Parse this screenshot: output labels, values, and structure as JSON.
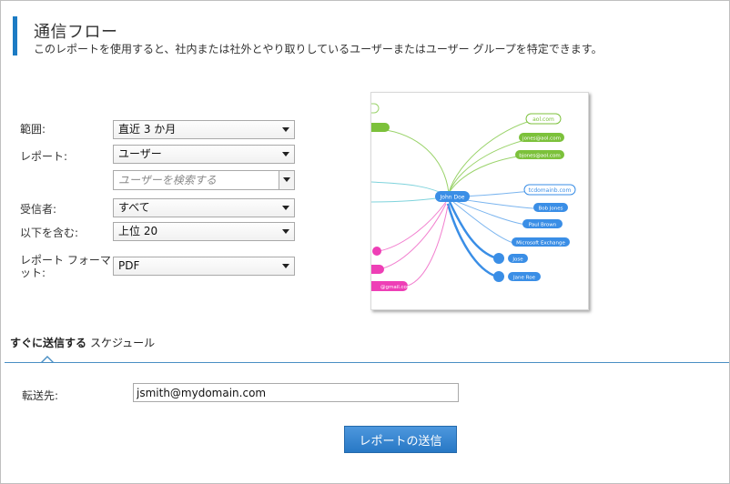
{
  "header": {
    "title": "通信フロー",
    "description": "このレポートを使用すると、社内または社外とやり取りしているユーザーまたはユーザー グループを特定できます。"
  },
  "form": {
    "range": {
      "label": "範囲:",
      "value": "直近 3 か月"
    },
    "report": {
      "label": "レポート:",
      "value": "ユーザー"
    },
    "user_search": {
      "placeholder": "ユーザーを検索する"
    },
    "recipients": {
      "label": "受信者:",
      "value": "すべて"
    },
    "include": {
      "label": "以下を含む:",
      "value": "上位 20"
    },
    "format": {
      "label": "レポート フォーマット:",
      "value": "PDF"
    }
  },
  "preview": {
    "center": "John Doe",
    "top_group": "aol.com",
    "top_nodes": [
      "jones@aol.com",
      "bjones@aol.com"
    ],
    "right_group": "tcdomainb.com",
    "right_nodes": [
      "Bob Jones",
      "Paul Brown",
      "Microsoft Exchange",
      "Jose",
      "Jane Roe"
    ],
    "left_node": "@gmail.com",
    "colors": {
      "green": "#7cc13b",
      "blue": "#3a8ee6",
      "pink": "#ee3fb6",
      "teal": "#5bc7d2"
    }
  },
  "tabs": {
    "send_now": "すぐに送信する",
    "schedule": "スケジュール"
  },
  "send": {
    "forward_label": "転送先:",
    "forward_value": "jsmith@mydomain.com",
    "button_label": "レポートの送信"
  }
}
